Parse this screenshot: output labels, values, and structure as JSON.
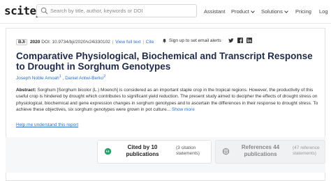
{
  "header": {
    "logo": "scite_",
    "search_placeholder": "Search by title, author, keywords or DOI",
    "nav": [
      "Assistant",
      "Product",
      "Solutions",
      "Pricing",
      "Log"
    ]
  },
  "paper": {
    "badge": "BJI",
    "year": "2020",
    "doi": "DOI: 10.9734/bji/2020/v24i330102",
    "view_full_text": "View full text",
    "cite": "Cite",
    "alert": "Sign up to set email alerts",
    "title": "Comparative Physiological, Biochemical and Transcript Response to Drought in Sorghum Genotypes",
    "author1": "Joseph Noble Amoah",
    "author1_sup": "1",
    "author2": "Daniel Antwi-Berko",
    "author2_sup": "2",
    "abstract_label": "Abstract:",
    "abstract_text": "Sorghum [Sorghum bicolor (L.) Moench] is considered as an important staple crop in the tropical regions. However, the productivity of this useful crop is hindered by drought which contributes to significant yield reduction. The present study aimed to decipher the effects of drought stress on physiological, biochemical and gene expression changes in sorghum genotypes and to ascertain the differences in their response to drought stress. To achieve these objectives, six sorghum genotypes were grown in pot culture...",
    "show_more": "Show more",
    "help_link": "Help me understand this report"
  },
  "stats": {
    "cited_line1": "Cited by 10",
    "cited_line2": "publications",
    "cited_sub1": "(3 citation",
    "cited_sub2": "statements)",
    "refs_line1": "References 44",
    "refs_line2": "publications",
    "refs_sub1": "(47 reference",
    "refs_sub2": "statements)"
  }
}
